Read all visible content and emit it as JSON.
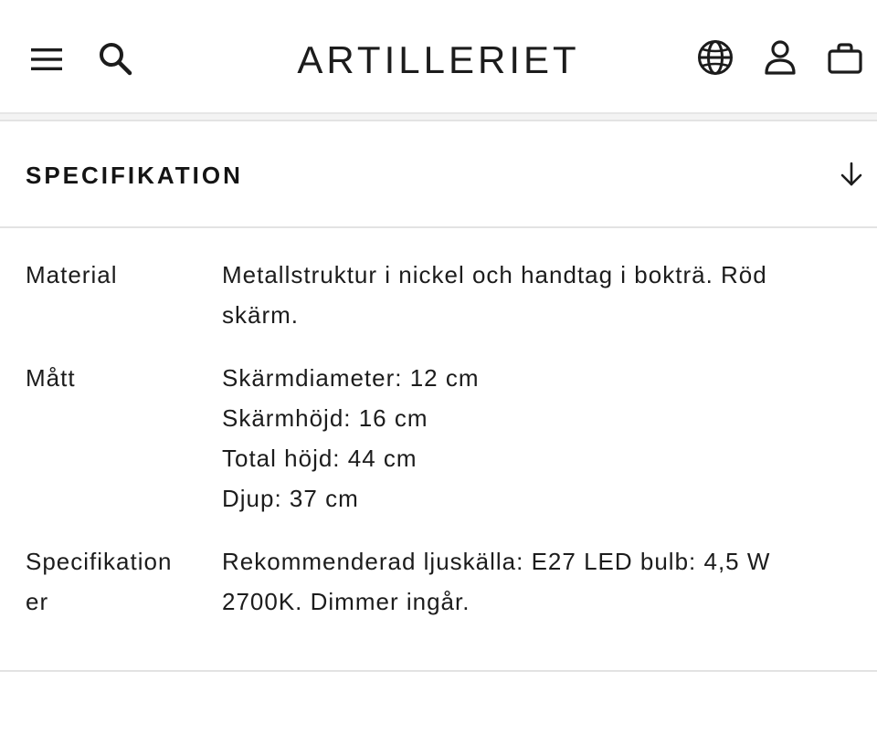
{
  "header": {
    "logo": "ARTILLERIET",
    "icons": {
      "menu": "hamburger-menu-icon",
      "search": "search-icon",
      "language": "globe-icon",
      "account": "user-icon",
      "cart": "shopping-bag-icon"
    }
  },
  "accordion": {
    "title": "SPECIFIKATION",
    "toggle_icon": "arrow-down-icon"
  },
  "specs": [
    {
      "label_lines": [
        "Material"
      ],
      "value_lines": [
        "Metallstruktur i nickel och handtag i bokträ. Röd",
        "skärm."
      ]
    },
    {
      "label_lines": [
        "Mått"
      ],
      "value_lines": [
        "Skärmdiameter: 12 cm",
        "Skärmhöjd: 16 cm",
        "Total höjd: 44 cm",
        "Djup: 37 cm"
      ]
    },
    {
      "label_lines": [
        "Specifikation",
        "er"
      ],
      "value_lines": [
        "Rekommenderad ljuskälla: E27 LED bulb: 4,5 W",
        "2700K. Dimmer ingår."
      ]
    }
  ],
  "colors": {
    "text": "#1c1c1c",
    "divider": "#e3e3e3",
    "background": "#ffffff"
  }
}
